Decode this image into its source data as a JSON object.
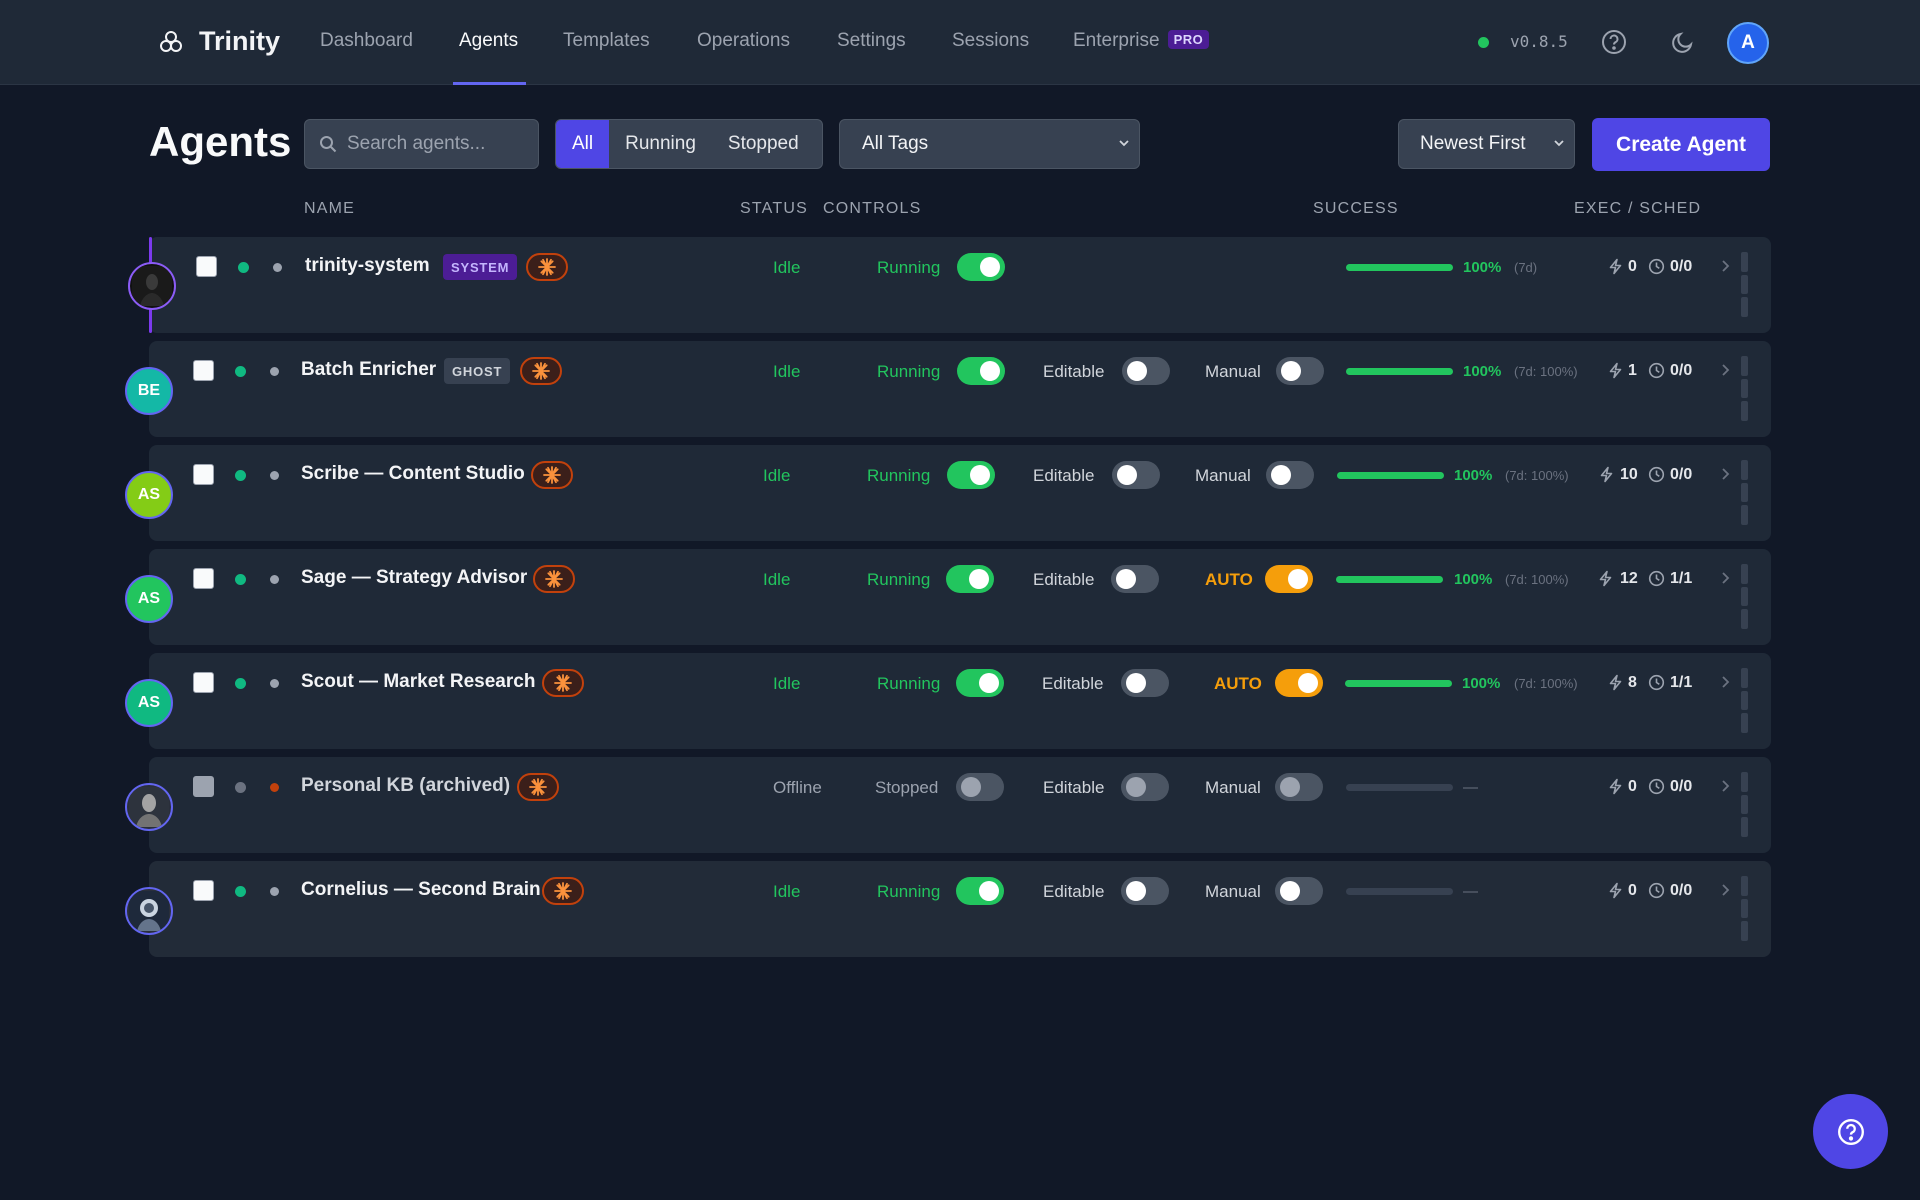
{
  "nav": {
    "brand": "Trinity",
    "links": [
      "Dashboard",
      "Agents",
      "Templates",
      "Operations",
      "Settings",
      "Sessions",
      "Enterprise"
    ],
    "pro_badge": "PRO",
    "version": "v0.8.5",
    "avatar_initial": "A",
    "active": "Agents"
  },
  "toolbar": {
    "title": "Agents",
    "search_placeholder": "Search agents...",
    "filters": [
      "All",
      "Running",
      "Stopped"
    ],
    "active_filter": "All",
    "tags_select": "All Tags",
    "sort_select": "Newest First",
    "create_label": "Create Agent"
  },
  "headers": {
    "name": "NAME",
    "status": "STATUS",
    "controls": "CONTROLS",
    "success": "SUCCESS",
    "exec_sched": "EXEC / SCHED"
  },
  "agents": [
    {
      "name": "trinity-system",
      "badge": "SYSTEM",
      "status": "Idle",
      "run_label": "Running",
      "running": true,
      "success_pct": "100%",
      "success_sub": "(7d)",
      "exec": "0",
      "sched": "0/0",
      "avatar": "portrait"
    },
    {
      "name": "Batch Enricher",
      "badge": "GHOST",
      "status": "Idle",
      "run_label": "Running",
      "running": true,
      "edit_label": "Editable",
      "mode_label": "Manual",
      "success_pct": "100%",
      "success_sub": "(7d: 100%)",
      "exec": "1",
      "sched": "0/0",
      "avatar_initials": "BE",
      "avatar_color": "#14b8a6"
    },
    {
      "name": "Scribe — Content Studio",
      "status": "Idle",
      "run_label": "Running",
      "running": true,
      "edit_label": "Editable",
      "mode_label": "Manual",
      "success_pct": "100%",
      "success_sub": "(7d: 100%)",
      "exec": "10",
      "sched": "0/0",
      "avatar_initials": "AS",
      "avatar_color": "#84cc16"
    },
    {
      "name": "Sage — Strategy Advisor",
      "status": "Idle",
      "run_label": "Running",
      "running": true,
      "edit_label": "Editable",
      "mode_label": "AUTO",
      "success_pct": "100%",
      "success_sub": "(7d: 100%)",
      "exec": "12",
      "sched": "1/1",
      "avatar_initials": "AS",
      "avatar_color": "#22c55e"
    },
    {
      "name": "Scout — Market Research",
      "status": "Idle",
      "run_label": "Running",
      "running": true,
      "edit_label": "Editable",
      "mode_label": "AUTO",
      "success_pct": "100%",
      "success_sub": "(7d: 100%)",
      "exec": "8",
      "sched": "1/1",
      "avatar_initials": "AS",
      "avatar_color": "#10b981"
    },
    {
      "name": "Personal KB (archived)",
      "status": "Offline",
      "run_label": "Stopped",
      "running": false,
      "edit_label": "Editable",
      "mode_label": "Manual",
      "success_pct": "—",
      "exec": "0",
      "sched": "0/0",
      "avatar": "portrait"
    },
    {
      "name": "Cornelius — Second Brain",
      "status": "Idle",
      "run_label": "Running",
      "running": true,
      "edit_label": "Editable",
      "mode_label": "Manual",
      "success_pct": "—",
      "exec": "0",
      "sched": "0/0",
      "avatar": "portrait"
    }
  ],
  "colors": {
    "accent": "#4f46e5",
    "success": "#22c55e",
    "auto": "#f59e0b",
    "offline_dot": "#c2410c"
  }
}
